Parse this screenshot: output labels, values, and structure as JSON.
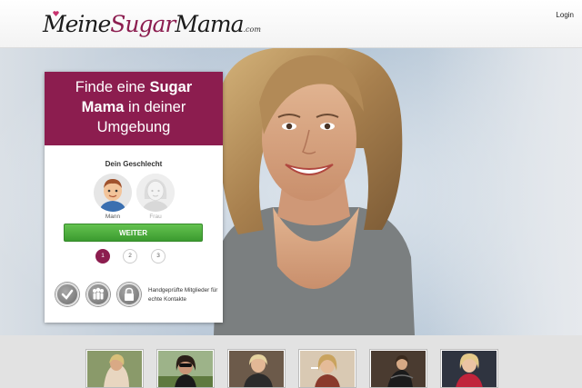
{
  "header": {
    "logo_parts": [
      "Meine",
      "Sugar",
      "Mama",
      ".com"
    ],
    "login_label": "Login"
  },
  "card": {
    "headline_pre": "Finde eine ",
    "headline_strong1": "Sugar",
    "headline_strong2": "Mama",
    "headline_post1": " in deiner",
    "headline_post2": "Umgebung",
    "gender_title": "Dein Geschlecht",
    "gender_male": "Mann",
    "gender_female": "Frau",
    "button_label": "WEITER",
    "steps": [
      "1",
      "2",
      "3"
    ],
    "trust_text": "Handgeprüfte Mitglieder für echte Kontakte"
  },
  "colors": {
    "brand": "#8c1d4f",
    "button": "#4caf3c"
  }
}
